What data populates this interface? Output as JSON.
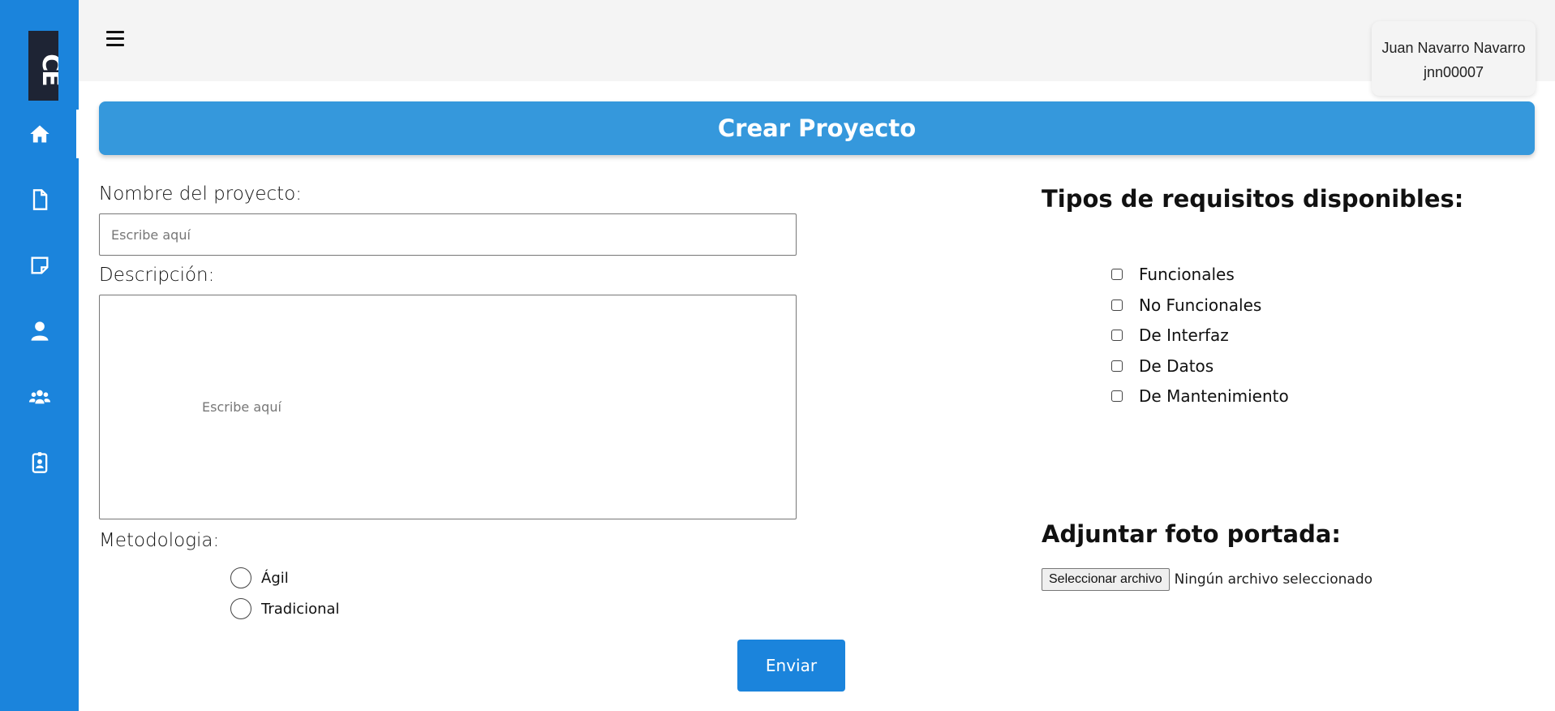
{
  "header": {
    "user_name": "Juan Navarro Navarro",
    "user_id": "jnn00007"
  },
  "sidebar": {
    "logo_text": "CE",
    "items": [
      {
        "icon": "home-icon",
        "active": true
      },
      {
        "icon": "document-icon",
        "active": false
      },
      {
        "icon": "note-icon",
        "active": false
      },
      {
        "icon": "user-icon",
        "active": false
      },
      {
        "icon": "group-icon",
        "active": false
      },
      {
        "icon": "id-badge-icon",
        "active": false
      }
    ]
  },
  "page": {
    "title": "Crear Proyecto"
  },
  "form": {
    "name_label": "Nombre del proyecto:",
    "name_placeholder": "Escribe aquí",
    "description_label": "Descripción:",
    "description_placeholder": "Escribe aquí",
    "methodology_label": "Metodologia:",
    "methodology_options": [
      "Ágil",
      "Tradicional"
    ],
    "submit_label": "Enviar"
  },
  "requirements": {
    "title": "Tipos de requisitos disponibles:",
    "options": [
      "Funcionales",
      "No Funcionales",
      "De Interfaz",
      "De Datos",
      "De Mantenimiento"
    ]
  },
  "cover": {
    "title": "Adjuntar foto portada:",
    "button_label": "Seleccionar archivo",
    "status": "Ningún archivo seleccionado"
  },
  "colors": {
    "sidebar": "#1b84dc",
    "title_bar": "#3598dc",
    "header_bg": "#f4f4f4"
  }
}
